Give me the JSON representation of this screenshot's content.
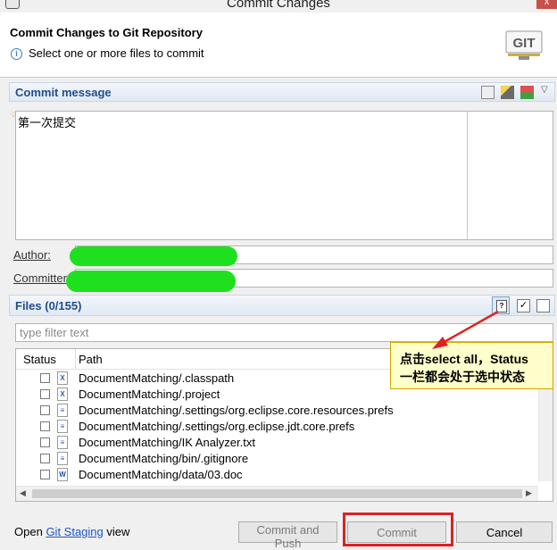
{
  "window": {
    "title": "Commit Changes",
    "close_symbol": "x"
  },
  "banner": {
    "title": "Commit Changes to Git Repository",
    "subtitle": "Select one or more files to commit",
    "logo_text": "GIT"
  },
  "message_section": {
    "title": "Commit message",
    "message": "第一次提交"
  },
  "author": {
    "label": "Author:"
  },
  "committer": {
    "label": "Committer:"
  },
  "files_section": {
    "title": "Files (0/155)",
    "filter_placeholder": "type filter text",
    "columns": [
      "Status",
      "Path"
    ],
    "rows": [
      {
        "path": "DocumentMatching/.classpath",
        "icon": "xml-file-icon"
      },
      {
        "path": "DocumentMatching/.project",
        "icon": "xml-file-icon"
      },
      {
        "path": "DocumentMatching/.settings/org.eclipse.core.resources.prefs",
        "icon": "text-file-icon"
      },
      {
        "path": "DocumentMatching/.settings/org.eclipse.jdt.core.prefs",
        "icon": "text-file-icon"
      },
      {
        "path": "DocumentMatching/IK Analyzer.txt",
        "icon": "text-file-icon"
      },
      {
        "path": "DocumentMatching/bin/.gitignore",
        "icon": "text-file-icon"
      },
      {
        "path": "DocumentMatching/data/03.doc",
        "icon": "word-file-icon"
      }
    ]
  },
  "annotation": {
    "line1": "点击select all，Status",
    "line2": "一栏都会处于选中状态",
    "color": "#e02020"
  },
  "footer": {
    "open_prefix": "Open",
    "staging_link": "Git Staging",
    "open_suffix": "view",
    "commit_and_push": "Commit and Push",
    "commit": "Commit",
    "cancel": "Cancel"
  },
  "colors": {
    "section_title": "#1f4e8c",
    "link": "#1a55c4",
    "redaction": "#1ee01e",
    "highlight": "#e02020"
  }
}
